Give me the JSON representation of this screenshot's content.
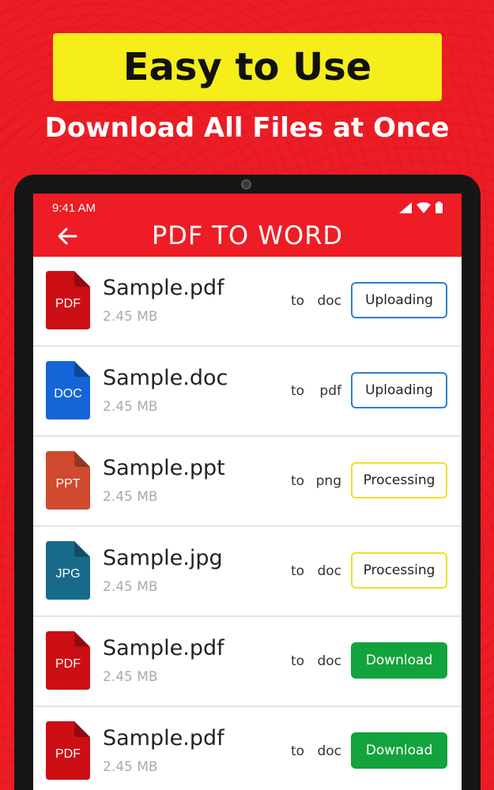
{
  "promo": {
    "headline": "Easy to Use",
    "subheadline": "Download All Files at Once"
  },
  "status_bar": {
    "time": "9:41 AM"
  },
  "app_bar": {
    "title": "PDF TO WORD"
  },
  "colors": {
    "brand_red": "#ee1c25",
    "banner_yellow": "#f6ee1a",
    "uploading_border": "#2b7fd0",
    "processing_border": "#ece02a",
    "download_green": "#12a33c"
  },
  "files": [
    {
      "icon_label": "PDF",
      "icon_color": "#cc0f14",
      "name": "Sample.pdf",
      "size": "2.45 MB",
      "to_label": "to",
      "target": "doc",
      "status": "Uploading",
      "status_type": "uploading"
    },
    {
      "icon_label": "DOC",
      "icon_color": "#1565d8",
      "name": "Sample.doc",
      "size": "2.45 MB",
      "to_label": "to",
      "target": "pdf",
      "status": "Uploading",
      "status_type": "uploading"
    },
    {
      "icon_label": "PPT",
      "icon_color": "#cf4a2e",
      "name": "Sample.ppt",
      "size": "2.45 MB",
      "to_label": "to",
      "target": "png",
      "status": "Processing",
      "status_type": "processing"
    },
    {
      "icon_label": "JPG",
      "icon_color": "#176a8a",
      "name": "Sample.jpg",
      "size": "2.45 MB",
      "to_label": "to",
      "target": "doc",
      "status": "Processing",
      "status_type": "processing"
    },
    {
      "icon_label": "PDF",
      "icon_color": "#cc0f14",
      "name": "Sample.pdf",
      "size": "2.45 MB",
      "to_label": "to",
      "target": "doc",
      "status": "Download",
      "status_type": "download"
    },
    {
      "icon_label": "PDF",
      "icon_color": "#cc0f14",
      "name": "Sample.pdf",
      "size": "2.45 MB",
      "to_label": "to",
      "target": "doc",
      "status": "Download",
      "status_type": "download"
    }
  ]
}
